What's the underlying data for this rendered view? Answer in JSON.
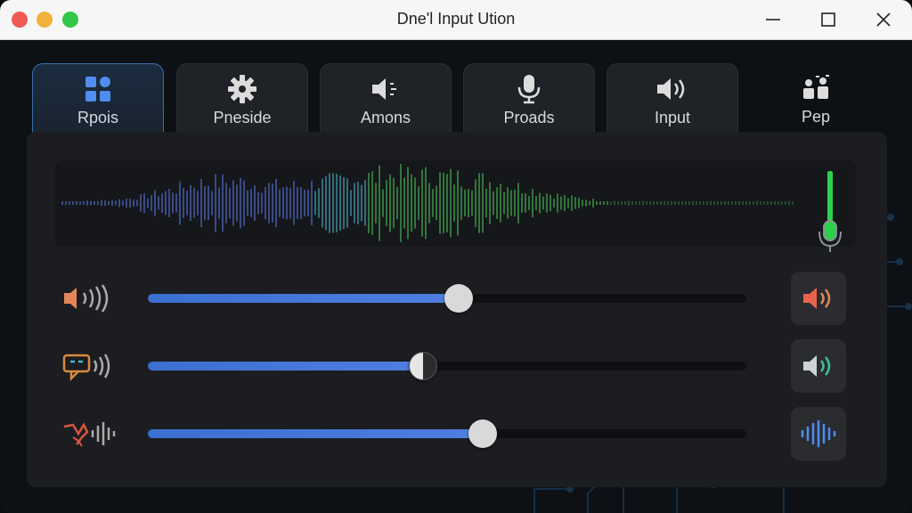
{
  "window": {
    "title": "Dne'l Input Ution"
  },
  "tabs": [
    {
      "label": "Rpois",
      "icon": "grid-icon",
      "active": true
    },
    {
      "label": "Pneside",
      "icon": "gear-icon",
      "active": false
    },
    {
      "label": "Amons",
      "icon": "speaker-icon",
      "active": false
    },
    {
      "label": "Proads",
      "icon": "microphone-icon",
      "active": false
    },
    {
      "label": "Input",
      "icon": "speaker-wave-icon",
      "active": false
    },
    {
      "label": "Pep",
      "icon": "users-icon",
      "active": false
    }
  ],
  "sliders": [
    {
      "name": "speaker-volume",
      "value": 0.52,
      "icon": "speaker-icon",
      "button_icon": "speaker-wave-icon",
      "color": "#e87d55"
    },
    {
      "name": "chat-volume",
      "value": 0.46,
      "icon": "chat-icon",
      "button_icon": "speaker-wave-icon",
      "color": "#d98a3d"
    },
    {
      "name": "effects-volume",
      "value": 0.56,
      "icon": "waveform-icon",
      "button_icon": "waveform-icon",
      "color": "#d9573f"
    }
  ],
  "input_meter": {
    "level": 0.55,
    "icon": "microphone-icon"
  },
  "colors": {
    "accent": "#4f7fe0",
    "meter": "#2bd14a"
  }
}
